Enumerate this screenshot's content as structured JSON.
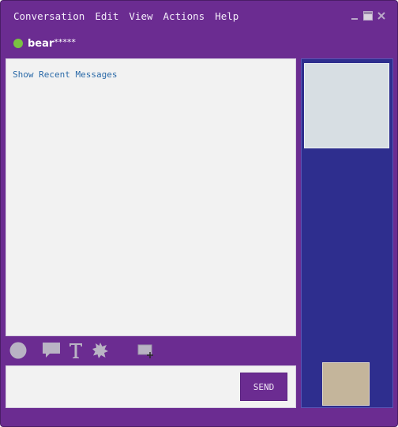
{
  "menu": {
    "conversation": "Conversation",
    "edit": "Edit",
    "view": "View",
    "actions": "Actions",
    "help": "Help"
  },
  "contact": {
    "name": "bear",
    "masked": "*****",
    "status_color": "#7ac142"
  },
  "chat": {
    "show_recent": "Show Recent Messages"
  },
  "toolbar": {
    "icons": [
      "emoticon-icon",
      "speech-bubble-icon",
      "font-icon",
      "nudge-icon",
      "send-file-icon"
    ]
  },
  "composer": {
    "value": "",
    "send_label": "SEND"
  },
  "colors": {
    "window": "#6b2c91",
    "side_panel": "#2e2e8e",
    "link": "#2b6aa8"
  }
}
